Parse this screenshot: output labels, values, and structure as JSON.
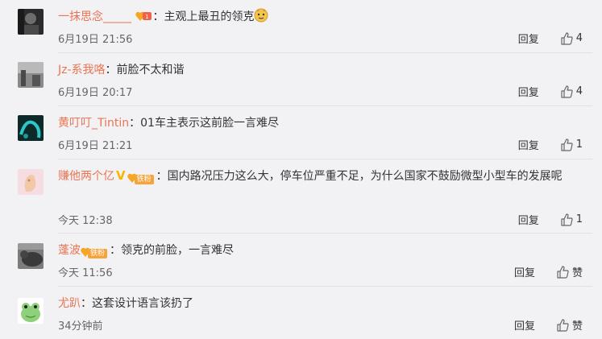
{
  "colors": {
    "username": "#eb7350",
    "badge": "#f8a23a",
    "background": "#f2f2f5"
  },
  "comments": [
    {
      "username": "一抹思念_____",
      "sep": "：",
      "text": "主观上最丑的领克",
      "time": "6月19日 21:56",
      "reply": "回复",
      "likes": "4",
      "emoji": "doge-icon",
      "badge": "heart-badge-icon"
    },
    {
      "username": "Jz-系我咯",
      "sep": "：",
      "text": "前脸不太和谐",
      "time": "6月19日 20:17",
      "reply": "回复",
      "likes": "4"
    },
    {
      "username": "黄叮叮_Tintin",
      "sep": "：",
      "text": "01车主表示这前脸一言难尽",
      "time": "6月19日 21:21",
      "reply": "回复",
      "likes": "1"
    },
    {
      "username": "赚他两个亿",
      "sep": "：",
      "text": "国内路况压力这么大，停车位严重不足，为什么国家不鼓励微型小型车的发展呢",
      "time": "今天 12:38",
      "reply": "回复",
      "likes": "1",
      "fan_label": "铁粉"
    },
    {
      "username": "蓬波",
      "sep": "：",
      "text": "领克的前脸，一言难尽",
      "time": "今天 11:56",
      "reply": "回复",
      "likes": "赞",
      "fan_label": "铁粉"
    },
    {
      "username": "尤趴",
      "sep": "：",
      "text": "这套设计语言该扔了",
      "time": "34分钟前",
      "reply": "回复",
      "likes": "赞"
    }
  ]
}
